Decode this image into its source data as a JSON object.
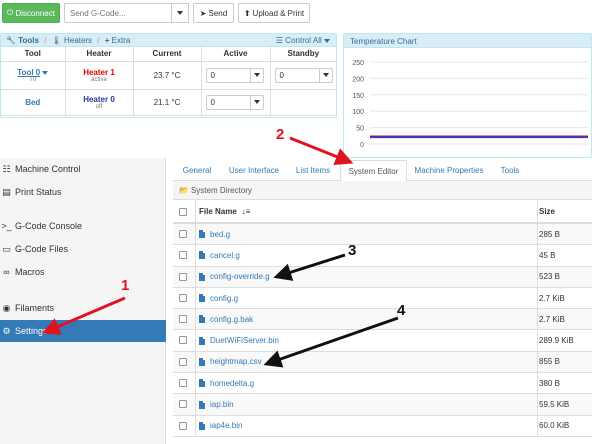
{
  "toolbar": {
    "disconnect_label": "Disconnect",
    "gcode_placeholder": "Send G-Code...",
    "send_label": "Send",
    "upload_label": "Upload & Print"
  },
  "tools_panel": {
    "title": "Tools",
    "heaters_link": "Heaters",
    "extra_link": "Extra",
    "control_all": "Control All",
    "columns": [
      "Tool",
      "Heater",
      "Current",
      "Active",
      "Standby"
    ],
    "rows": [
      {
        "tool": "Tool 0",
        "tool_sub": "T0",
        "heater": "Heater 1",
        "heater_state": "active",
        "current": "23.7 °C",
        "active": "0",
        "standby": "0"
      },
      {
        "tool": "Bed",
        "heater": "Heater 0",
        "heater_state": "off",
        "current": "21.1 °C",
        "active": "0"
      }
    ]
  },
  "temp_chart": {
    "title": "Temperature Chart",
    "chart_data": {
      "type": "line",
      "title": "Temperature Chart",
      "yticks": [
        250,
        200,
        150,
        100,
        50,
        0
      ],
      "ylim": [
        0,
        250
      ],
      "series": [
        {
          "values": [
            23,
            23,
            23,
            23,
            23,
            23,
            23,
            23
          ],
          "color": "#d4004d"
        },
        {
          "values": [
            21,
            21,
            21,
            21,
            21,
            21,
            21,
            21
          ],
          "color": "#2f3fb1"
        }
      ]
    }
  },
  "nav": {
    "items": [
      {
        "label": "Machine Control",
        "icon": "sliders-icon"
      },
      {
        "label": "Print Status",
        "icon": "print-icon"
      },
      {
        "label": "G-Code Console",
        "icon": "terminal-icon"
      },
      {
        "label": "G-Code Files",
        "icon": "folder-icon"
      },
      {
        "label": "Macros",
        "icon": "link-icon"
      },
      {
        "label": "Filaments",
        "icon": "dot-circle-icon"
      },
      {
        "label": "Settings",
        "icon": "gear-icon"
      }
    ]
  },
  "tabs": [
    "General",
    "User Interface",
    "List Items",
    "System Editor",
    "Machine Properties",
    "Tools"
  ],
  "system_directory": "System Directory",
  "files": {
    "col_name": "File Name",
    "col_size": "Size",
    "rows": [
      {
        "name": "bed.g",
        "size": "285 B"
      },
      {
        "name": "cancel.g",
        "size": "45 B"
      },
      {
        "name": "config-override.g",
        "size": "523 B"
      },
      {
        "name": "config.g",
        "size": "2.7 KiB"
      },
      {
        "name": "config.g.bak",
        "size": "2.7 KiB"
      },
      {
        "name": "DuetWiFiServer.bin",
        "size": "289.9 KiB"
      },
      {
        "name": "heightmap.csv",
        "size": "855 B"
      },
      {
        "name": "homedelta.g",
        "size": "380 B"
      },
      {
        "name": "iap.bin",
        "size": "59.5 KiB"
      },
      {
        "name": "iap4e.bin",
        "size": "60.0 KiB"
      }
    ]
  },
  "annotations": [
    "1",
    "2",
    "3",
    "4"
  ],
  "colors": {
    "accent": "#337ab7",
    "success": "#5cb85c",
    "arrow_red": "#e0141e",
    "panel_head": "#d9edf7"
  }
}
